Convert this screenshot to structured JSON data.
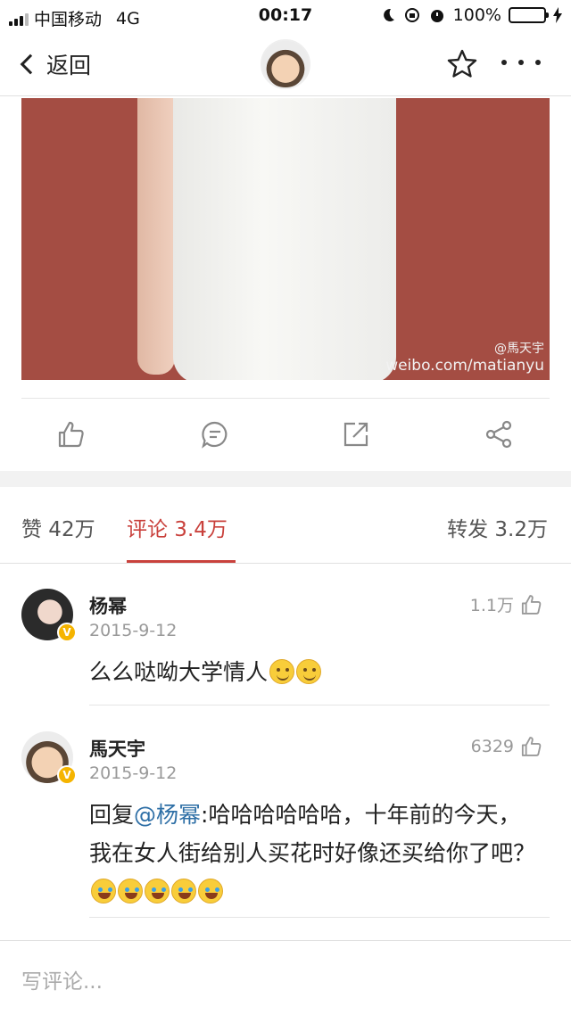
{
  "status_bar": {
    "carrier": "中国移动",
    "network": "4G",
    "time": "00:17",
    "battery": "100%"
  },
  "nav": {
    "back_label": "返回"
  },
  "post_image": {
    "watermark_user": "@馬天宇",
    "watermark_url": "weibo.com/matianyu"
  },
  "tabs": {
    "likes_label": "赞 42万",
    "comments_label": "评论 3.4万",
    "reposts_label": "转发 3.2万"
  },
  "comments": [
    {
      "name": "杨幂",
      "date": "2015-9-12",
      "likes": "1.1万",
      "text": "么么哒呦大学情人"
    },
    {
      "name": "馬天宇",
      "date": "2015-9-12",
      "likes": "6329",
      "reply_prefix": "回复",
      "mention": "@杨幂",
      "text": ":哈哈哈哈哈哈，十年前的今天，我在女人街给别人买花时好像还买给你了吧？"
    }
  ],
  "composer": {
    "placeholder": "写评论..."
  },
  "colors": {
    "accent_red": "#c9413c",
    "mention_blue": "#2e6fa6",
    "battery_green": "#4cd964",
    "verified_badge": "#f5b400"
  }
}
